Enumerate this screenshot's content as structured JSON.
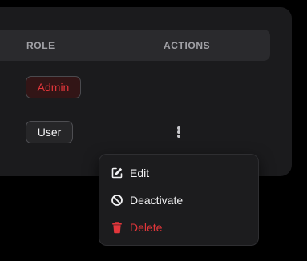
{
  "table": {
    "columns": {
      "role": "ROLE",
      "actions": "ACTIONS"
    },
    "rows": [
      {
        "role": "Admin",
        "role_color": "#e2363b"
      },
      {
        "role": "User",
        "role_color": "#f2f2f4"
      }
    ]
  },
  "actions_menu": {
    "items": [
      {
        "label": "Edit",
        "icon": "edit-icon"
      },
      {
        "label": "Deactivate",
        "icon": "ban-icon"
      },
      {
        "label": "Delete",
        "icon": "trash-icon",
        "color": "#e2363b"
      }
    ]
  },
  "colors": {
    "background": "#000000",
    "card": "#1b1b1d",
    "header_row": "#2a2a2d",
    "danger": "#e2363b"
  }
}
